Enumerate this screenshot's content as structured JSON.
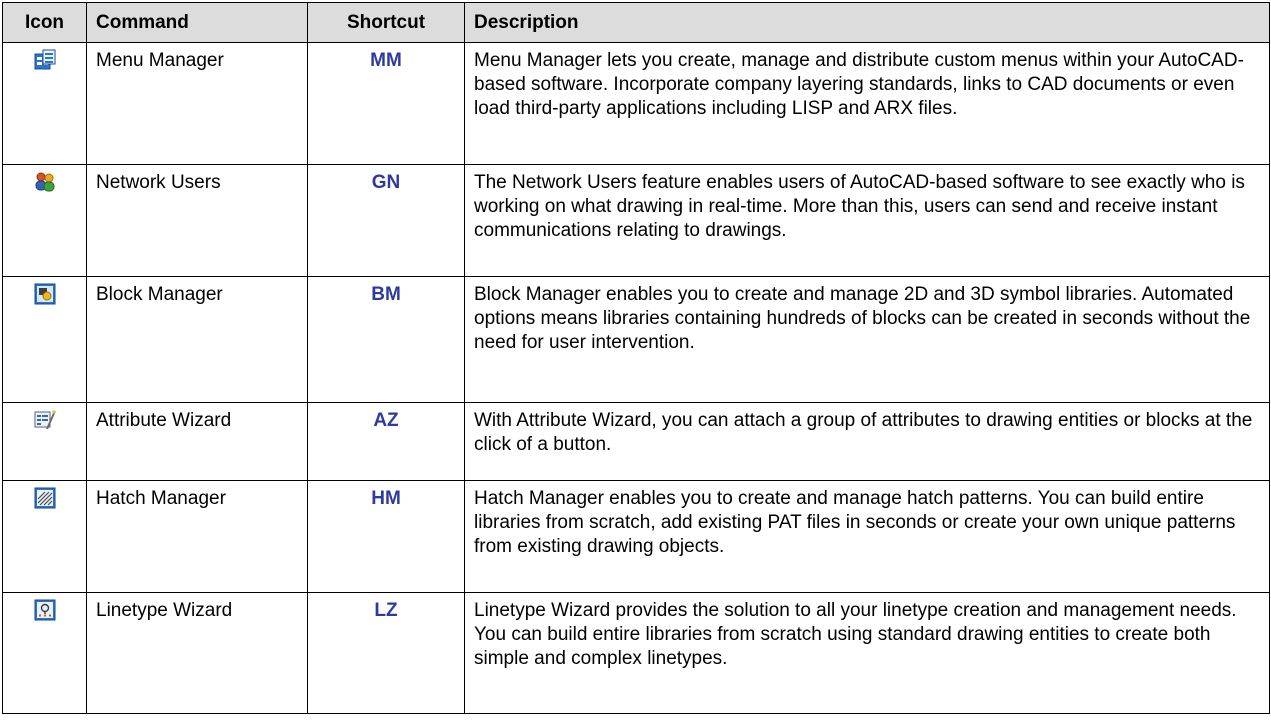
{
  "table": {
    "headers": {
      "icon": "Icon",
      "command": "Command",
      "shortcut": "Shortcut",
      "description": "Description"
    },
    "rows": [
      {
        "icon": "menu-manager-icon",
        "command": "Menu Manager",
        "shortcut": "MM",
        "description": "Menu Manager lets you create, manage and distribute custom menus within your AutoCAD-based software. Incorporate company layering standards, links to CAD documents or even load third-party applications including LISP and ARX files."
      },
      {
        "icon": "network-users-icon",
        "command": "Network Users",
        "shortcut": "GN",
        "description": "The Network Users feature enables users of AutoCAD-based software to see exactly who is working on what drawing in real-time. More than this, users can send and receive instant communications relating to drawings."
      },
      {
        "icon": "block-manager-icon",
        "command": "Block Manager",
        "shortcut": "BM",
        "description": "Block Manager enables you to create and manage 2D and 3D symbol libraries. Automated options means libraries containing hundreds of blocks can be created in seconds without the need for user intervention."
      },
      {
        "icon": "attribute-wizard-icon",
        "command": "Attribute Wizard",
        "shortcut": "AZ",
        "description": "With Attribute Wizard, you can attach a group of attributes to drawing entities or blocks at the click of a button."
      },
      {
        "icon": "hatch-manager-icon",
        "command": "Hatch Manager",
        "shortcut": "HM",
        "description": "Hatch Manager enables you to create and manage hatch patterns. You can build entire libraries from scratch, add existing PAT files in seconds or create your own unique patterns from existing drawing objects."
      },
      {
        "icon": "linetype-wizard-icon",
        "command": "Linetype Wizard",
        "shortcut": "LZ",
        "description": "Linetype Wizard provides the solution to all your linetype creation and management needs. You can build entire libraries from scratch using standard drawing entities to create both simple and complex linetypes."
      }
    ]
  },
  "colors": {
    "header_background": "#dcdcdc",
    "shortcut_text": "#2e3a9e",
    "border": "#000000"
  }
}
